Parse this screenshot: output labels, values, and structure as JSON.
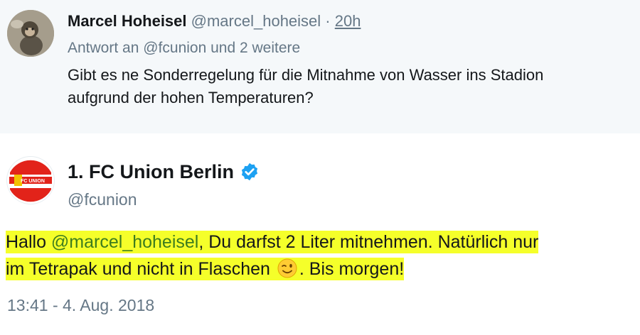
{
  "reply_tweet": {
    "author_name": "Marcel Hoheisel",
    "author_handle": "@marcel_hoheisel",
    "separator": "·",
    "time": "20h",
    "reply_to_prefix": "Antwort an",
    "reply_to_handle": "@fcunion",
    "reply_to_suffix": "und 2 weitere",
    "text_line1": "Gibt es ne Sonderregelung für die Mitnahme von Wasser ins Stadion",
    "text_line2": "aufgrund der hohen Temperaturen?",
    "avatar_icon": "monkey-avatar"
  },
  "main_tweet": {
    "author_name": "1. FC Union Berlin",
    "author_handle": "@fcunion",
    "verified_icon": "verified-badge-icon",
    "avatar_icon": "fc-union-logo",
    "avatar_logo_text": "FC UNION",
    "text_prefix": "Hallo ",
    "text_mention": "@marcel_hoheisel",
    "text_line1_rest": ", Du darfst 2 Liter mitnehmen. Natürlich nur",
    "text_line2_a": "im Tetrapak und nicht in Flaschen ",
    "emoji": "winking-face-emoji",
    "text_line2_b": ". Bis morgen!",
    "timestamp": "13:41 - 4. Aug. 2018",
    "highlight_color": "#f5ff2a",
    "mention_color": "#3d7c1e",
    "verified_color": "#1da1f2"
  }
}
